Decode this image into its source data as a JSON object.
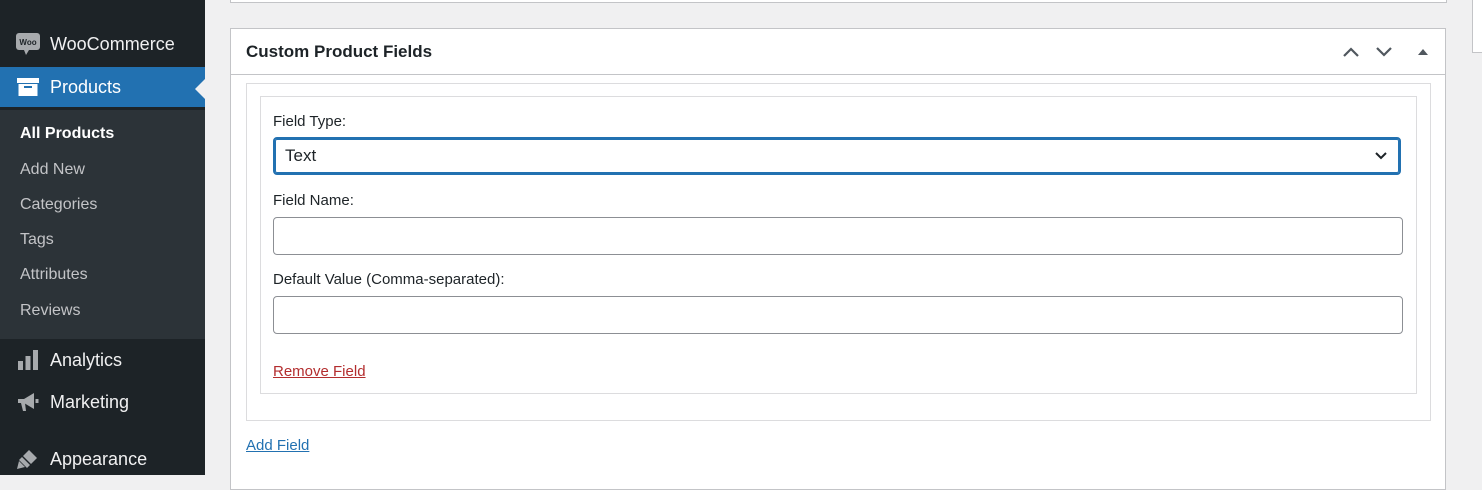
{
  "sidebar": {
    "items": [
      {
        "label": "WooCommerce",
        "icon": "woo-icon"
      },
      {
        "label": "Products",
        "icon": "archive-icon"
      },
      {
        "label": "Analytics",
        "icon": "bar-chart-icon"
      },
      {
        "label": "Marketing",
        "icon": "megaphone-icon"
      },
      {
        "label": "Appearance",
        "icon": "paintbrush-icon"
      }
    ],
    "woo_badge": "Woo",
    "submenu": [
      "All Products",
      "Add New",
      "Categories",
      "Tags",
      "Attributes",
      "Reviews"
    ]
  },
  "postbox": {
    "title": "Custom Product Fields",
    "field_type_label": "Field Type:",
    "field_type_value": "Text",
    "field_name_label": "Field Name:",
    "field_name_value": "",
    "default_value_label": "Default Value (Comma-separated):",
    "default_value_value": "",
    "remove_field": "Remove Field",
    "add_field": "Add Field"
  },
  "colors": {
    "sidebar_bg": "#1d2327",
    "submenu_bg": "#2c3338",
    "accent": "#2271b1",
    "remove_link": "#b32d2e"
  }
}
